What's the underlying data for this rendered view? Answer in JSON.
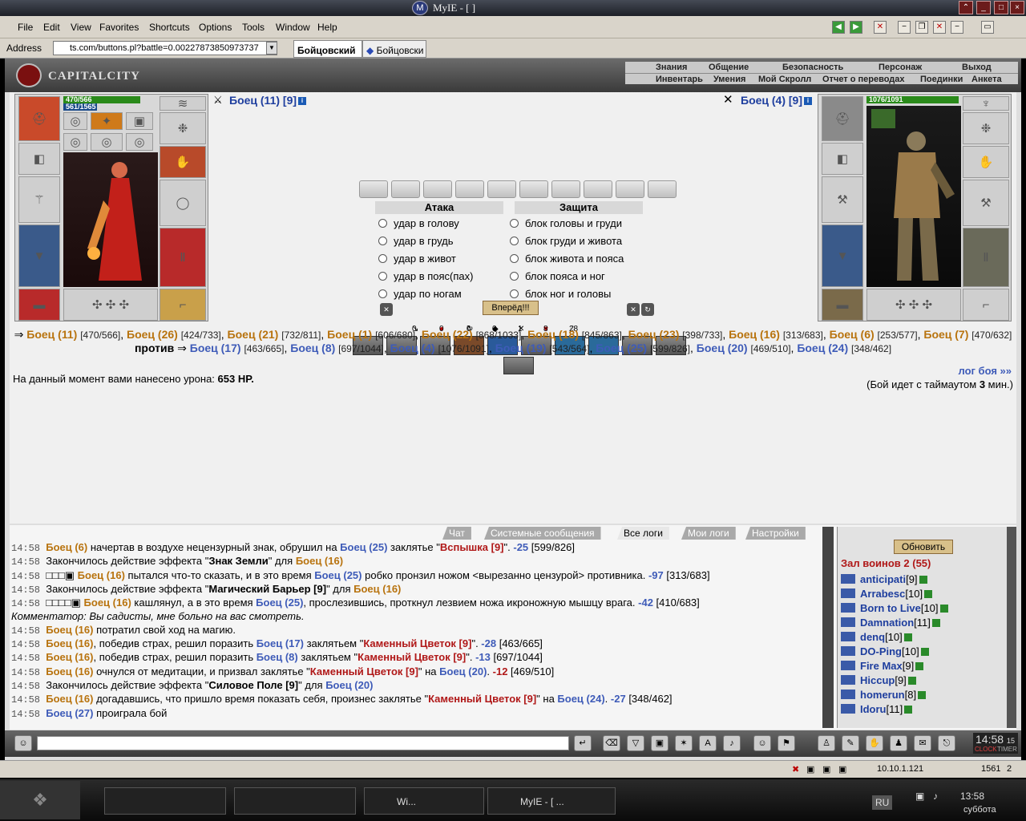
{
  "window": {
    "title": "MyIE - [                ]",
    "logo": "M"
  },
  "menu": {
    "items": [
      "File",
      "Edit",
      "View",
      "Favorites",
      "Shortcuts",
      "Options",
      "Tools",
      "Window",
      "Help"
    ]
  },
  "address": {
    "label": "Address",
    "url": "ts.com/buttons.pl?battle=0.00227873850973737",
    "tabs": [
      "Бойцовский",
      "Бойцовски"
    ]
  },
  "game": {
    "logo": "CAPITALCITY",
    "nav_top": [
      "Знания",
      "Общение",
      "Безопасность",
      "Персонаж",
      "Выход"
    ],
    "nav_bottom": [
      "Инвентарь",
      "Умения",
      "Мой Скролл",
      "Отчет о переводах",
      "Поединки",
      "Анкета"
    ]
  },
  "player": {
    "name": "Боец (11) [9]",
    "hp": "470/566",
    "mp": "561/1565",
    "hp_fill": 0.83,
    "mp_fill": 0.36
  },
  "enemy": {
    "name": "Боец (4) [9]",
    "hp": "1076/1091",
    "hp_fill": 0.99
  },
  "combat": {
    "attack_header": "Атака",
    "defense_header": "Защита",
    "attacks": [
      "удар в голову",
      "удар в грудь",
      "удар в живот",
      "удар в пояс(пах)",
      "удар по ногам"
    ],
    "blocks": [
      "блок головы и груди",
      "блок груди и живота",
      "блок живота и пояса",
      "блок пояса и ног",
      "блок ног и головы"
    ],
    "forward_button": "Вперёд!!!",
    "stats": [
      "0",
      "0",
      "0",
      "0",
      "1",
      "8",
      "28"
    ]
  },
  "teams": {
    "left": [
      {
        "n": "Боец (11)",
        "hp": "[470/566]"
      },
      {
        "n": "Боец (26)",
        "hp": "[424/733]"
      },
      {
        "n": "Боец (21)",
        "hp": "[732/811]"
      },
      {
        "n": "Боец (1)",
        "hp": "[606/680]"
      },
      {
        "n": "Боец (22)",
        "hp": "[868/1033]"
      },
      {
        "n": "Боец (18)",
        "hp": "[845/863]"
      },
      {
        "n": "Боец (23)",
        "hp": "[398/733]"
      },
      {
        "n": "Боец (16)",
        "hp": "[313/683]"
      },
      {
        "n": "Боец (6)",
        "hp": "[253/577]"
      },
      {
        "n": "Боец (7)",
        "hp": "[470/632]"
      }
    ],
    "versus": "против",
    "right": [
      {
        "n": "Боец (17)",
        "hp": "[463/665]"
      },
      {
        "n": "Боец (8)",
        "hp": "[697/1044]"
      },
      {
        "n": "Боец (4)",
        "hp": "[1076/1091]"
      },
      {
        "n": "Боец (19)",
        "hp": "[543/564]"
      },
      {
        "n": "Боец (25)",
        "hp": "[599/826]"
      },
      {
        "n": "Боец (20)",
        "hp": "[469/510]"
      },
      {
        "n": "Боец (24)",
        "hp": "[348/462]"
      }
    ]
  },
  "damage": {
    "prefix": "На данный момент вами нанесено урона: ",
    "value": "653 HP."
  },
  "log_link": "лог боя »»",
  "timeout": {
    "prefix": "(Бой идет с таймаутом ",
    "value": "3",
    "suffix": " мин.)"
  },
  "log_tabs": [
    "Чат",
    "Системные сообщения",
    "Все логи",
    "Мои логи",
    "Настройки"
  ],
  "log": [
    {
      "t": "14:58",
      "parts": [
        [
          "o",
          "Боец (6)"
        ],
        [
          "x",
          " начертав в воздухе нецензурный знак, обрушил на "
        ],
        [
          "b",
          "Боец (25)"
        ],
        [
          "x",
          " заклятье \""
        ],
        [
          "s",
          "Вспышка [9]"
        ],
        [
          "x",
          "\". "
        ],
        [
          "d",
          "-25"
        ],
        [
          "x",
          " [599/826]"
        ]
      ]
    },
    {
      "t": "14:58",
      "parts": [
        [
          "x",
          "Закончилось действие эффекта \""
        ],
        [
          "k",
          "Знак Земли"
        ],
        [
          "x",
          "\" для "
        ],
        [
          "o",
          "Боец (16)"
        ]
      ]
    },
    {
      "t": "14:58",
      "parts": [
        [
          "x",
          "□□□▣ "
        ],
        [
          "o",
          "Боец (16)"
        ],
        [
          "x",
          " пытался что-то сказать, и в это время "
        ],
        [
          "b",
          "Боец (25)"
        ],
        [
          "x",
          " робко пронзил ножом <вырезанно цензурой> противника. "
        ],
        [
          "d",
          "-97"
        ],
        [
          "x",
          " [313/683]"
        ]
      ]
    },
    {
      "t": "14:58",
      "parts": [
        [
          "x",
          "Закончилось действие эффекта \""
        ],
        [
          "k",
          "Магический Барьер [9]"
        ],
        [
          "x",
          "\" для "
        ],
        [
          "o",
          "Боец (16)"
        ]
      ]
    },
    {
      "t": "14:58",
      "parts": [
        [
          "x",
          "□□□□▣ "
        ],
        [
          "o",
          "Боец (16)"
        ],
        [
          "x",
          " кашлянул, а в это время "
        ],
        [
          "b",
          "Боец (25)"
        ],
        [
          "x",
          ", прослезившись, проткнул лезвием ножа икроножную мышцу врага. "
        ],
        [
          "d",
          "-42"
        ],
        [
          "x",
          " [410/683]"
        ]
      ]
    },
    {
      "t": "",
      "parts": [
        [
          "c",
          "Комментатор: Вы садисты, мне больно на вас смотреть."
        ]
      ]
    },
    {
      "t": "14:58",
      "parts": [
        [
          "o",
          "Боец (16)"
        ],
        [
          "x",
          " потратил свой ход на магию."
        ]
      ]
    },
    {
      "t": "14:58",
      "parts": [
        [
          "o",
          "Боец (16)"
        ],
        [
          "x",
          ", победив страх, решил поразить "
        ],
        [
          "b",
          "Боец (17)"
        ],
        [
          "x",
          " заклятьем \""
        ],
        [
          "s",
          "Каменный Цветок [9]"
        ],
        [
          "x",
          "\". "
        ],
        [
          "d",
          "-28"
        ],
        [
          "x",
          " [463/665]"
        ]
      ]
    },
    {
      "t": "14:58",
      "parts": [
        [
          "o",
          "Боец (16)"
        ],
        [
          "x",
          ", победив страх, решил поразить "
        ],
        [
          "b",
          "Боец (8)"
        ],
        [
          "x",
          " заклятьем \""
        ],
        [
          "s",
          "Каменный Цветок [9]"
        ],
        [
          "x",
          "\". "
        ],
        [
          "d",
          "-13"
        ],
        [
          "x",
          " [697/1044]"
        ]
      ]
    },
    {
      "t": "14:58",
      "parts": [
        [
          "o",
          "Боец (16)"
        ],
        [
          "x",
          " очнулся от медитации, и призвал заклятье \""
        ],
        [
          "s",
          "Каменный Цветок [9]"
        ],
        [
          "x",
          "\" на "
        ],
        [
          "b",
          "Боец (20)"
        ],
        [
          "x",
          ". "
        ],
        [
          "s",
          "-12"
        ],
        [
          "x",
          " [469/510]"
        ]
      ]
    },
    {
      "t": "14:58",
      "parts": [
        [
          "x",
          "Закончилось действие эффекта \""
        ],
        [
          "k",
          "Силовое Поле [9]"
        ],
        [
          "x",
          "\" для "
        ],
        [
          "b",
          "Боец (20)"
        ]
      ]
    },
    {
      "t": "14:58",
      "parts": [
        [
          "o",
          "Боец (16)"
        ],
        [
          "x",
          " догадавшись, что пришло время показать себя, произнес заклятье \""
        ],
        [
          "s",
          "Каменный Цветок [9]"
        ],
        [
          "x",
          "\" на "
        ],
        [
          "b",
          "Боец (24)"
        ],
        [
          "x",
          ". "
        ],
        [
          "d",
          "-27"
        ],
        [
          "x",
          " [348/462]"
        ]
      ]
    },
    {
      "t": "14:58",
      "parts": [
        [
          "b",
          "Боец (27)"
        ],
        [
          "x",
          " проиграла бой"
        ]
      ]
    }
  ],
  "room": {
    "refresh": "Обновить",
    "title": "Зал воинов 2 (55)",
    "users": [
      {
        "n": "anticipati",
        "l": "[9]"
      },
      {
        "n": "Arrabesc",
        "l": "[10]"
      },
      {
        "n": "Born to Live",
        "l": "[10]"
      },
      {
        "n": "Damnation",
        "l": "[11]"
      },
      {
        "n": "denq",
        "l": "[10]"
      },
      {
        "n": "DO-Ping",
        "l": "[10]"
      },
      {
        "n": "Fire Max",
        "l": "[9]"
      },
      {
        "n": "Hiccup",
        "l": "[9]"
      },
      {
        "n": "homerun",
        "l": "[8]"
      },
      {
        "n": "Idoru",
        "l": "[11]"
      }
    ]
  },
  "clock": {
    "time": "14:58",
    "sec": "15",
    "labels": [
      "CLOCK",
      "TIMER"
    ]
  },
  "status": {
    "ip": "10.10.1.121",
    "count": "1561",
    "extra": "2"
  },
  "taskbar": {
    "tasks": [
      "",
      "",
      "Wi...",
      "MyIE - [         ..."
    ],
    "lang": "RU",
    "time": "13:58",
    "day": "суббота"
  }
}
